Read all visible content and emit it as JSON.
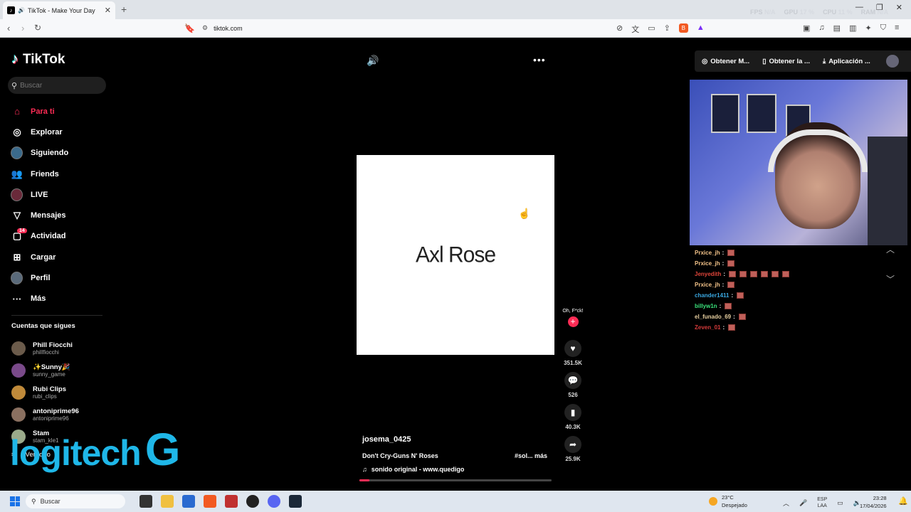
{
  "browser": {
    "tab_title": "TikTok - Make Your Day",
    "url": "tiktok.com",
    "perf": [
      {
        "label": "FPS",
        "value": "N/A"
      },
      {
        "label": "GPU",
        "value": "17 %"
      },
      {
        "label": "CPU",
        "value": "11 %"
      },
      {
        "label": "RAM",
        "value": "N/A"
      }
    ]
  },
  "tiktok": {
    "logo": "TikTok",
    "search_placeholder": "Buscar",
    "menu": [
      {
        "label": "Para ti",
        "icon": "home-icon"
      },
      {
        "label": "Explorar",
        "icon": "compass-icon"
      },
      {
        "label": "Siguiendo",
        "icon": "following-avatar"
      },
      {
        "label": "Friends",
        "icon": "friends-icon"
      },
      {
        "label": "LIVE",
        "icon": "live-avatar"
      },
      {
        "label": "Mensajes",
        "icon": "send-icon"
      },
      {
        "label": "Actividad",
        "icon": "activity-icon",
        "badge": "14"
      },
      {
        "label": "Cargar",
        "icon": "upload-icon"
      },
      {
        "label": "Perfil",
        "icon": "profile-avatar"
      },
      {
        "label": "Más",
        "icon": "more-icon"
      }
    ],
    "follows_title": "Cuentas que sigues",
    "follows": [
      {
        "name": "Phill Fiocchi",
        "handle": "phillfiocchi"
      },
      {
        "name": "✨Sunny🎉",
        "handle": "sunny_game"
      },
      {
        "name": "Rubi Clips",
        "handle": "rubi_clips"
      },
      {
        "name": "antoniprime96",
        "handle": "antoniprime96"
      },
      {
        "name": "Stam",
        "handle": "stam_kle1"
      }
    ],
    "see_all": "Ver todo",
    "video_text": "Axl Rose",
    "top_caption": "Oh, F*ck!",
    "likes": "351.5K",
    "comments": "526",
    "saves": "40.3K",
    "shares": "25.9K",
    "author": "josema_0425",
    "caption": "Don't Cry-Guns N' Roses",
    "hashtag": "#sol...",
    "more_label": "más",
    "sound": "sonido original - www.quedigo",
    "progress": 0.05,
    "header_buttons": [
      "Obtener M...",
      "Obtener la ...",
      "Aplicación ..."
    ]
  },
  "overlay": {
    "logo": "logitech"
  },
  "chat": [
    {
      "user": "Prxice_jh",
      "color": "#f5c48a",
      "emotes": 1
    },
    {
      "user": "Prxice_jh",
      "color": "#f5c48a",
      "emotes": 1
    },
    {
      "user": "Jenyedith",
      "color": "#e0453a",
      "emotes": 6
    },
    {
      "user": "Prxice_jh",
      "color": "#f5c48a",
      "emotes": 1
    },
    {
      "user": "chander1411",
      "color": "#3aa7e0",
      "emotes": 1
    },
    {
      "user": "billyw1n",
      "color": "#3ae07a",
      "emotes": 1
    },
    {
      "user": "el_funado_69",
      "color": "#e8d0a0",
      "emotes": 1
    },
    {
      "user": "Zeven_01",
      "color": "#d43a3a",
      "emotes": 1
    }
  ],
  "taskbar": {
    "search_placeholder": "Buscar",
    "temp": "23°C",
    "weather": "Despejado",
    "lang_top": "ESP",
    "lang_bottom": "LAA",
    "time": "23:28",
    "date": "17/04/2026"
  }
}
